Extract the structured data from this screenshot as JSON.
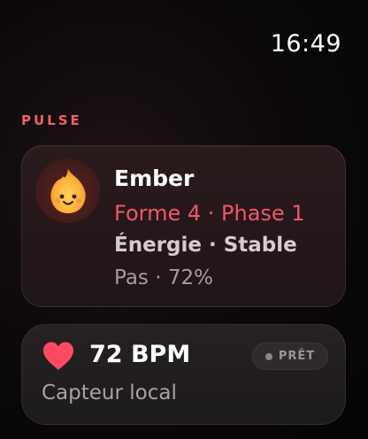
{
  "status_bar": {
    "time": "16:49"
  },
  "section": {
    "label": "PULSE"
  },
  "pet_card": {
    "avatar_icon": "flame-creature-icon",
    "name": "Ember",
    "phase": "Forme 4 · Phase 1",
    "energy": "Énergie · Stable",
    "steps": "Pas · 72%"
  },
  "heart_card": {
    "icon": "heart-icon",
    "bpm": "72 BPM",
    "status": "PRÊT",
    "sensor": "Capteur local"
  },
  "colors": {
    "accent": "#f0606c",
    "phase": "#f0566a",
    "heart": "#ff4a62"
  }
}
